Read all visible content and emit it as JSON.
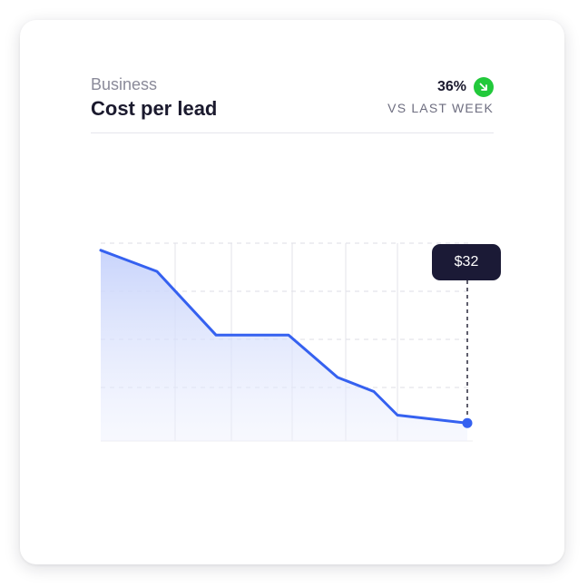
{
  "header": {
    "category": "Business",
    "title": "Cost per lead",
    "change_value": "36%",
    "change_direction_icon": "arrow-down-right-icon",
    "change_color": "#22c93b",
    "compare_label": "VS LAST WEEK"
  },
  "tooltip": {
    "label": "$32"
  },
  "chart_data": {
    "type": "area",
    "title": "",
    "xlabel": "",
    "ylabel": "",
    "ylim": [
      0,
      4.2
    ],
    "grid": true,
    "line_color": "#3561f0",
    "x": [
      0,
      1,
      2,
      3,
      4,
      5,
      6,
      7
    ],
    "values": [
      4.05,
      3.6,
      2.25,
      2.25,
      1.35,
      1.05,
      0.55,
      0.38
    ],
    "highlight": {
      "index": 7,
      "label": "$32"
    }
  }
}
